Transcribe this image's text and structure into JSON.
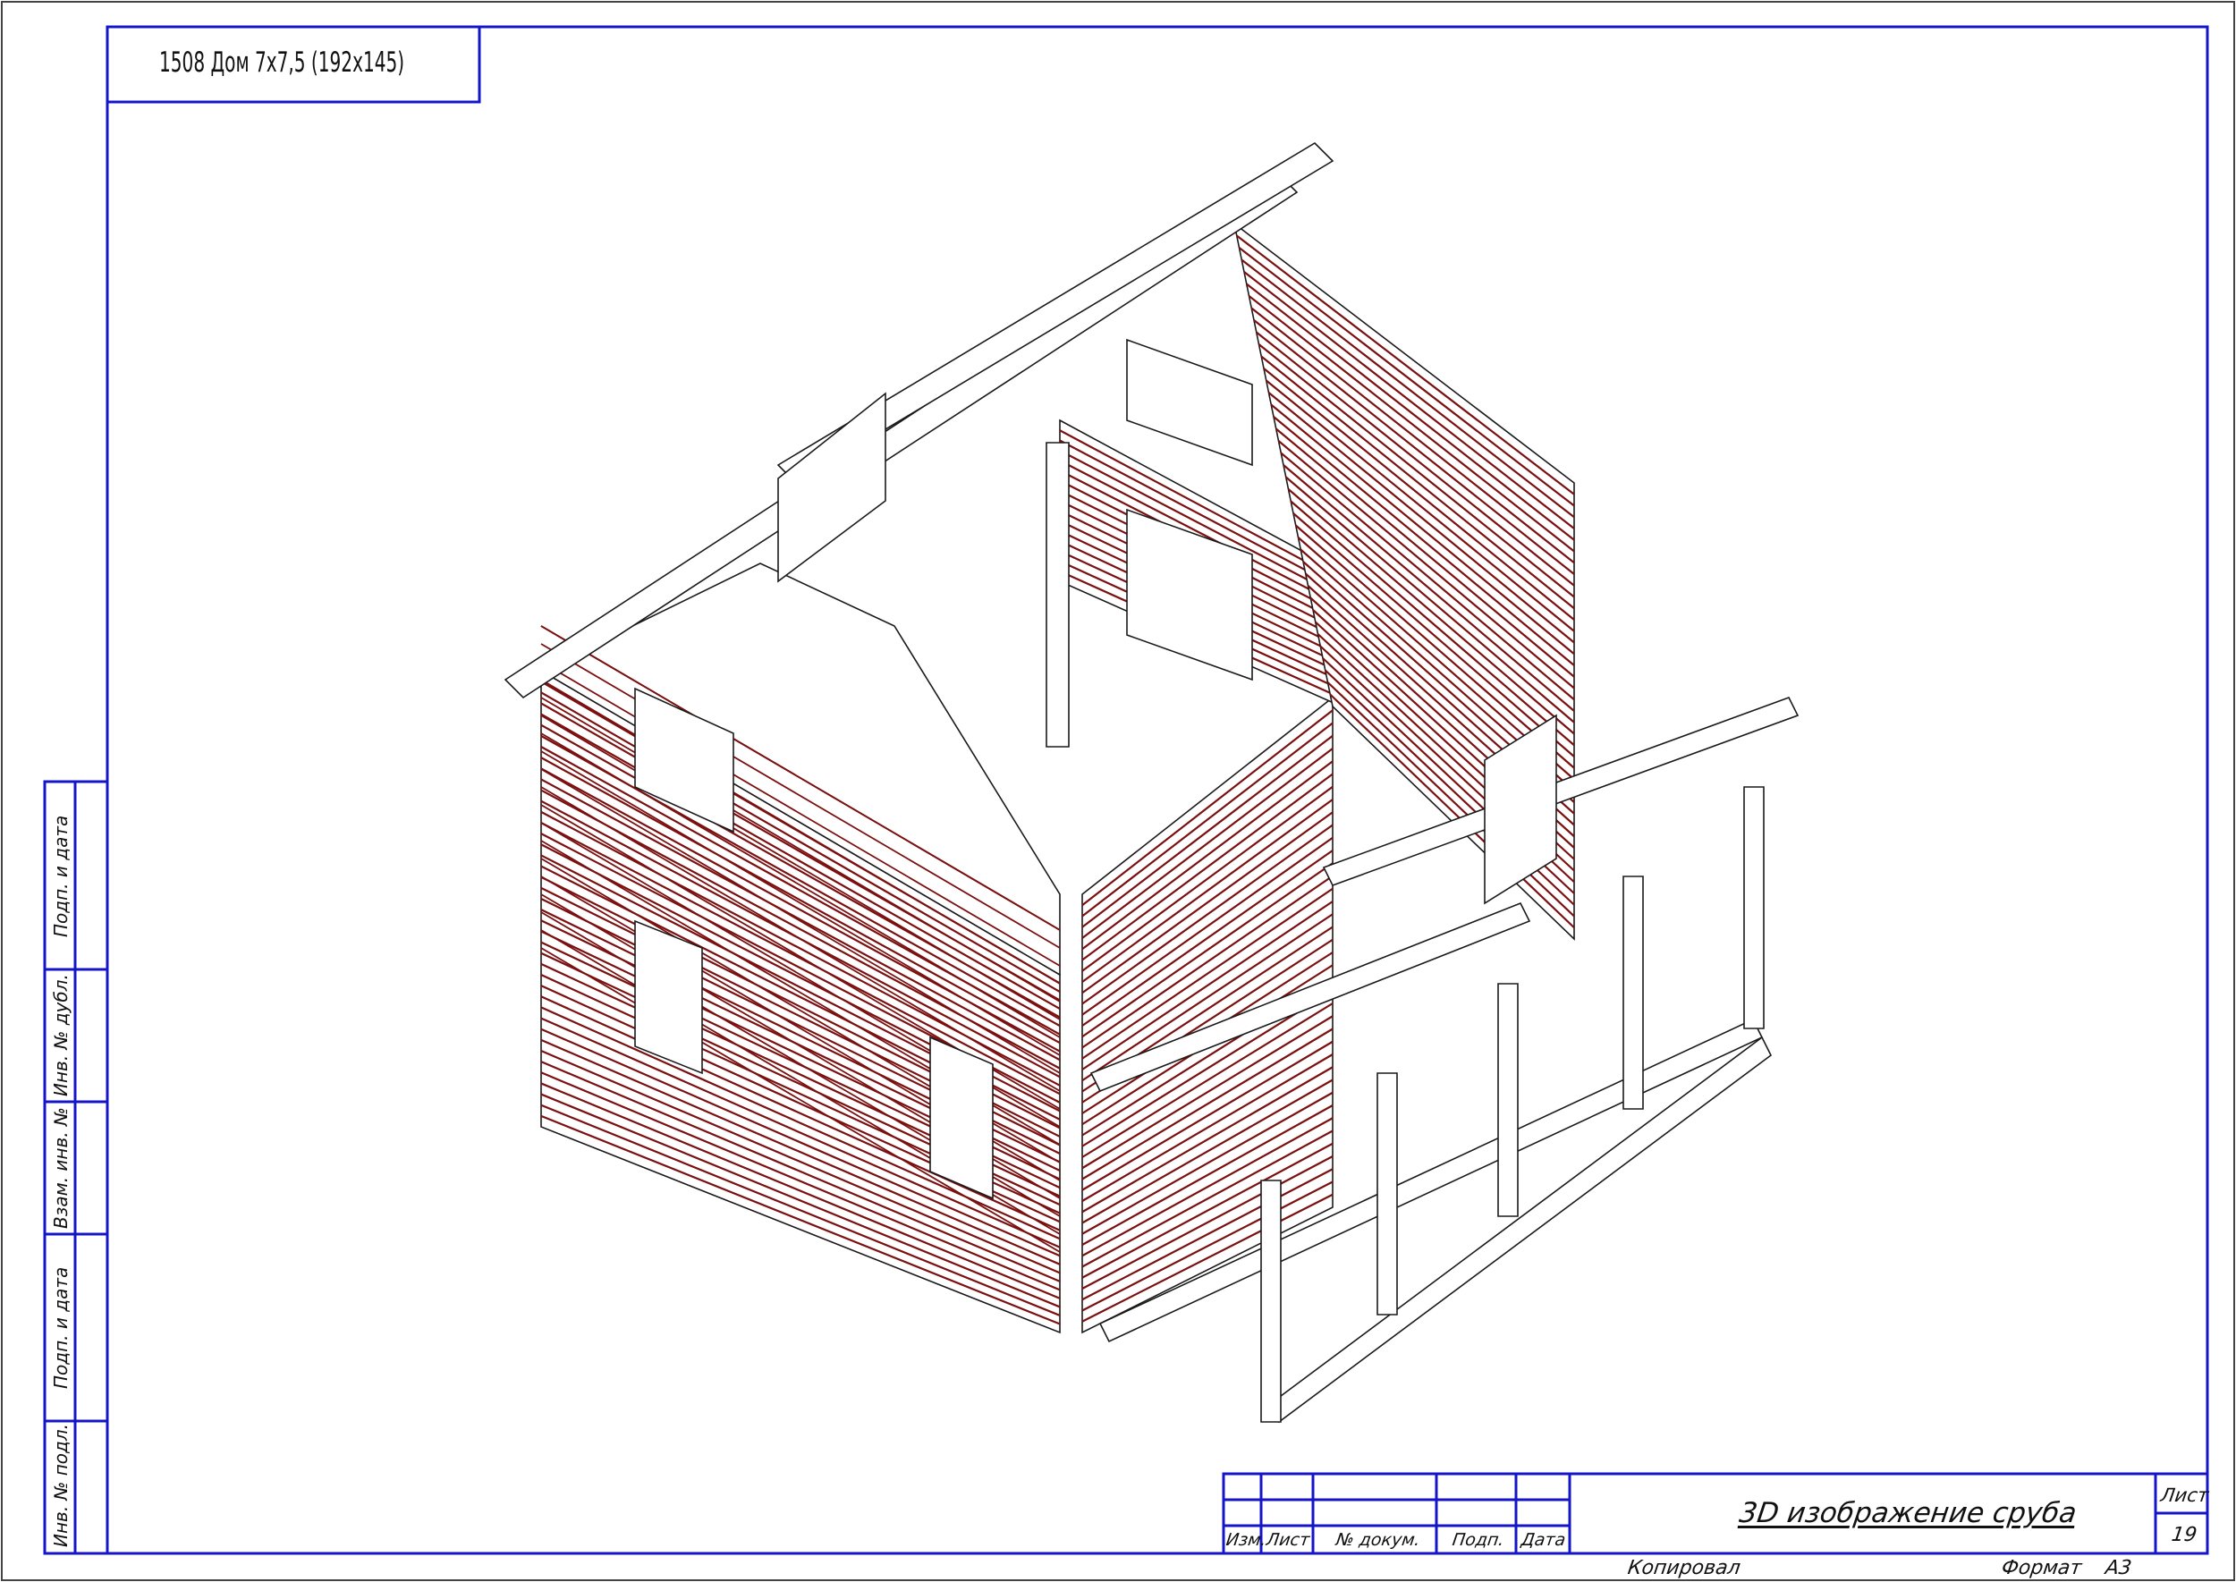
{
  "project_title": "1508 Дом 7х7,5 (192х145)",
  "side_stamp": [
    "Подп. и дата",
    "Инв. № дубл.",
    "Взам. инв. №",
    "Подп. и дата",
    "Инв. № подл."
  ],
  "title_block": {
    "columns": [
      "Изм.",
      "Лист",
      "№ докум.",
      "Подп.",
      "Дата"
    ],
    "drawing_name": "3D изображение сруба",
    "sheet_label": "Лист",
    "sheet_number": "19"
  },
  "footer": {
    "copied_label": "Копировал",
    "format_label": "Формат",
    "format_value": "А3"
  },
  "colors": {
    "frame": "#1414c8",
    "outline": "#ffffff",
    "log_line": "#7a1010",
    "edge": "#1a1a1a"
  }
}
